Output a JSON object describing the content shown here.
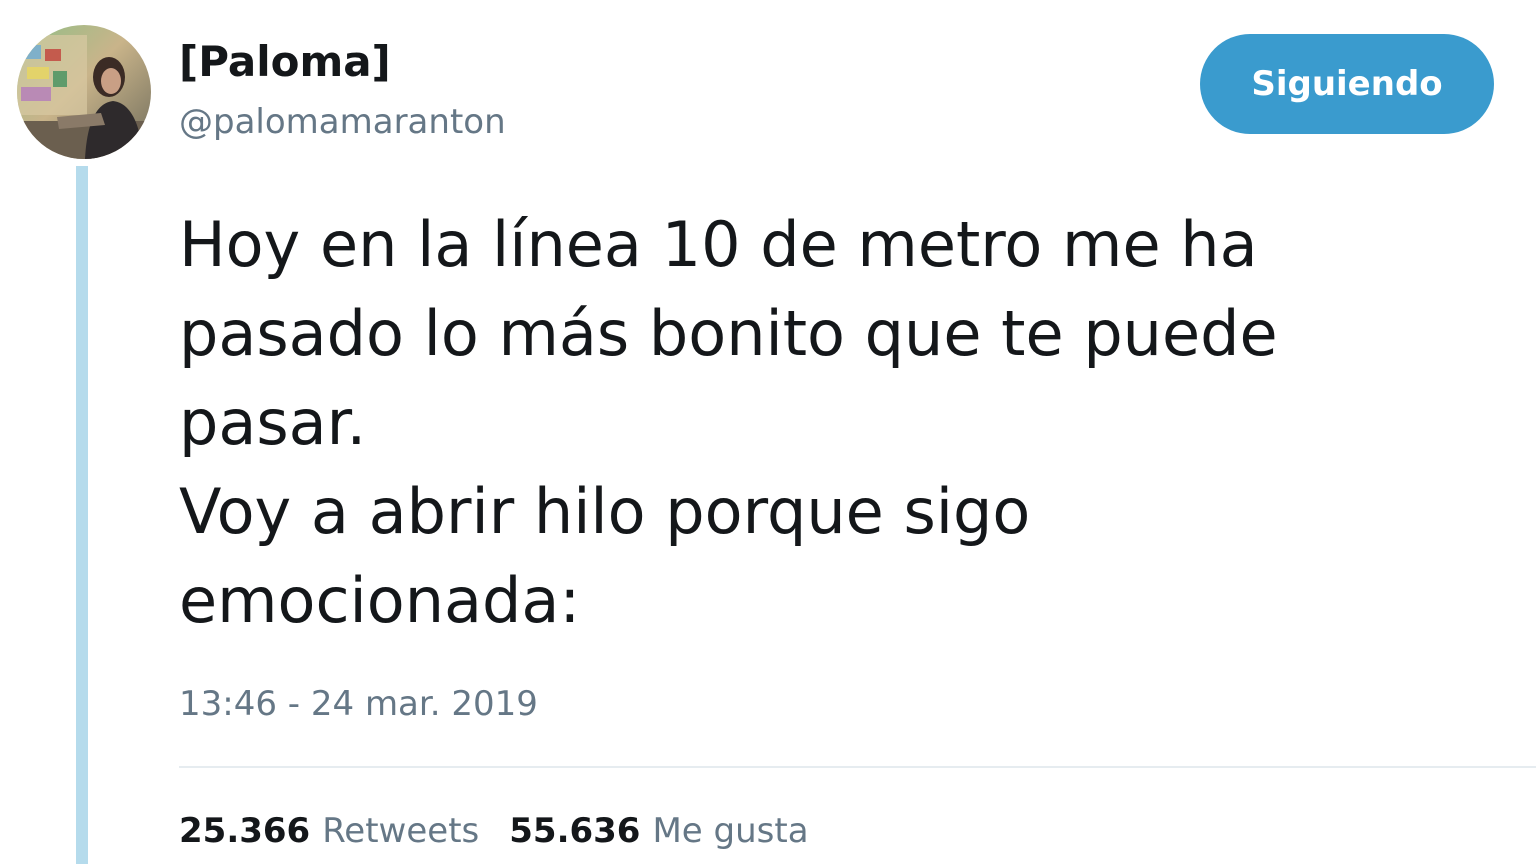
{
  "user": {
    "display_name": "[Paloma]",
    "handle": "@palomamaranton"
  },
  "follow_button": {
    "label": "Siguiendo",
    "color": "#3a9bce"
  },
  "tweet": {
    "lines": [
      "Hoy en la línea 10 de metro me ha",
      "pasado lo más bonito que te puede",
      "pasar.",
      "Voy a abrir hilo porque sigo",
      "emocionada:"
    ],
    "timestamp": "13:46 - 24 mar. 2019"
  },
  "stats": {
    "retweets_count": "25.366",
    "retweets_label": "Retweets",
    "likes_count": "55.636",
    "likes_label": "Me gusta"
  },
  "thread_line_color": "#b5dbec",
  "avatar_icon": "profile-photo"
}
